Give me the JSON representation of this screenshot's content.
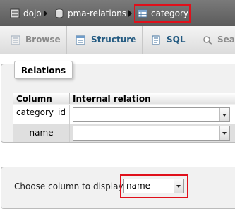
{
  "breadcrumb": {
    "items": [
      {
        "label": "dojo",
        "icon": "server-icon"
      },
      {
        "label": "pma-relations",
        "icon": "database-icon"
      },
      {
        "label": "category",
        "icon": "table-icon",
        "highlighted": true
      }
    ]
  },
  "tabs": [
    {
      "label": "Browse",
      "icon": "browse-icon",
      "state": "disabled"
    },
    {
      "label": "Structure",
      "icon": "structure-icon",
      "state": "normal"
    },
    {
      "label": "SQL",
      "icon": "sql-icon",
      "state": "normal"
    },
    {
      "label": "Sea",
      "icon": "search-icon",
      "state": "disabled"
    }
  ],
  "relations": {
    "legend": "Relations",
    "headers": {
      "column": "Column",
      "internal_relation": "Internal relation"
    },
    "rows": [
      {
        "column": "category_id",
        "value": ""
      },
      {
        "column": "name",
        "value": ""
      }
    ]
  },
  "display": {
    "label": "Choose column to display:",
    "selected": "name"
  },
  "colors": {
    "breadcrumb_bg": "#6b6b6b",
    "tab_link": "#235a81",
    "highlight_border": "#e0101b",
    "fieldset_bg": "#f1f1f1"
  }
}
